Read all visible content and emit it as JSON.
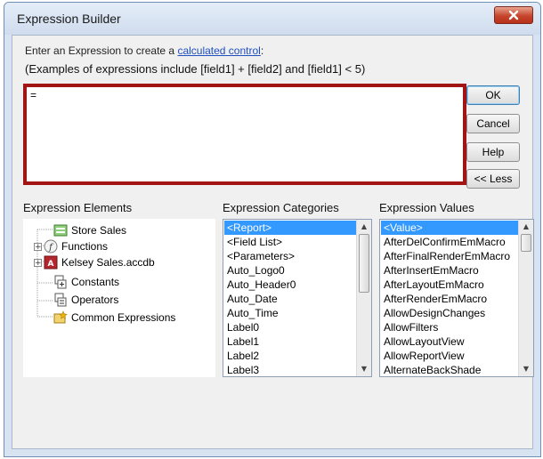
{
  "window": {
    "title": "Expression Builder"
  },
  "instructions": {
    "prefix": "Enter an Expression to create a ",
    "link": "calculated control",
    "suffix": ":",
    "examples": "(Examples of expressions include [field1] + [field2] and [field1] < 5)"
  },
  "expression": {
    "value": "="
  },
  "buttons": {
    "ok": "OK",
    "cancel": "Cancel",
    "help": "Help",
    "less": "<< Less"
  },
  "elements_pane": {
    "label": "Expression Elements",
    "items": [
      {
        "label": "Store Sales",
        "icon": "form-icon",
        "expander": ""
      },
      {
        "label": "Functions",
        "icon": "function-icon",
        "expander": "+"
      },
      {
        "label": "Kelsey Sales.accdb",
        "icon": "database-icon",
        "expander": "+"
      },
      {
        "label": "Constants",
        "icon": "constants-icon",
        "expander": ""
      },
      {
        "label": "Operators",
        "icon": "operators-icon",
        "expander": ""
      },
      {
        "label": "Common Expressions",
        "icon": "common-expressions-icon",
        "expander": ""
      }
    ]
  },
  "categories_pane": {
    "label": "Expression Categories",
    "items": [
      "<Report>",
      "<Field List>",
      "<Parameters>",
      "Auto_Logo0",
      "Auto_Header0",
      "Auto_Date",
      "Auto_Time",
      "Label0",
      "Label1",
      "Label2",
      "Label3"
    ],
    "selected_index": 0
  },
  "values_pane": {
    "label": "Expression Values",
    "items": [
      "<Value>",
      "AfterDelConfirmEmMacro",
      "AfterFinalRenderEmMacro",
      "AfterInsertEmMacro",
      "AfterLayoutEmMacro",
      "AfterRenderEmMacro",
      "AllowDesignChanges",
      "AllowFilters",
      "AllowLayoutView",
      "AllowReportView",
      "AlternateBackShade"
    ],
    "selected_index": 0
  },
  "colors": {
    "selection": "#3399ff",
    "expression_border": "#a31515",
    "link": "#1f4fbf",
    "close_button": "#c6452c"
  }
}
